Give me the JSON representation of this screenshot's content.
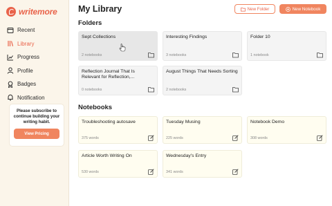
{
  "app": {
    "logo_text": "writemore"
  },
  "sidebar": {
    "items": [
      {
        "label": "Recent",
        "icon": "clock-icon",
        "active": false
      },
      {
        "label": "Library",
        "icon": "library-icon",
        "active": true
      },
      {
        "label": "Progress",
        "icon": "chart-icon",
        "active": false
      },
      {
        "label": "Profile",
        "icon": "user-icon",
        "active": false
      },
      {
        "label": "Badges",
        "icon": "badge-icon",
        "active": false
      },
      {
        "label": "Notification",
        "icon": "bell-icon",
        "active": false
      }
    ],
    "promo": {
      "text": "Please subscribe to continue building your writing habit.",
      "button_label": "View Pricing"
    }
  },
  "header": {
    "title": "My Library",
    "new_folder_label": "New Folder",
    "new_notebook_label": "New Notebook"
  },
  "folders": {
    "heading": "Folders",
    "items": [
      {
        "title": "Sept Collections",
        "meta": "2 notebooks"
      },
      {
        "title": "Interesting Findings",
        "meta": "3 notebooks"
      },
      {
        "title": "Folder 10",
        "meta": "1 notebook"
      },
      {
        "title": "Reflection Journal That Is Relevant for Reflection,...",
        "meta": "0 notebooks"
      },
      {
        "title": "August Things That Needs Sorting",
        "meta": "2 notebooks"
      }
    ]
  },
  "notebooks": {
    "heading": "Notebooks",
    "items": [
      {
        "title": "Troubleshooting autosave",
        "meta": "375 words"
      },
      {
        "title": "Tuesday Musing",
        "meta": "225 words"
      },
      {
        "title": "Notebook Demo",
        "meta": "308 words"
      },
      {
        "title": "Article Worth Writing On",
        "meta": "530 words"
      },
      {
        "title": "Wednesday's Entry",
        "meta": "341 words"
      }
    ]
  },
  "colors": {
    "accent": "#f0855f",
    "brand": "#e9634a",
    "sidebar_bg": "#fbf5ea"
  }
}
